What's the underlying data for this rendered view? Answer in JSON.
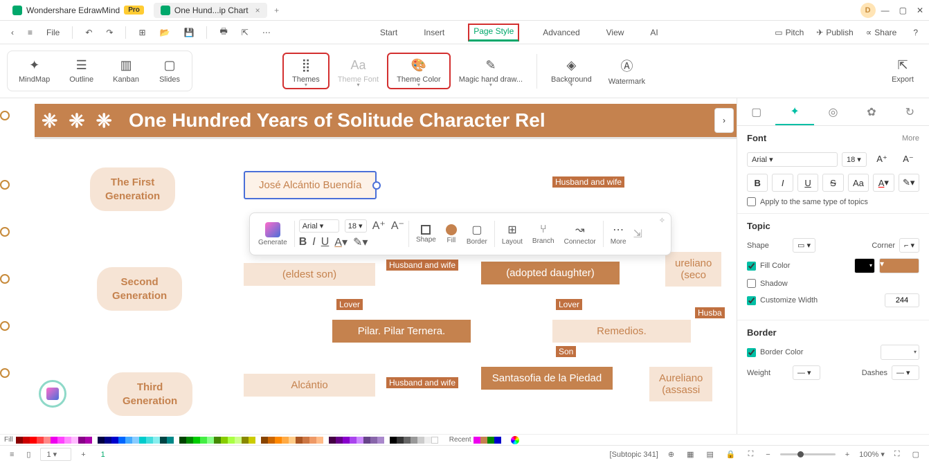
{
  "titlebar": {
    "app_name": "Wondershare EdrawMind",
    "pro_badge": "Pro",
    "doc_tab": "One Hund...ip Chart",
    "avatar_letter": "D"
  },
  "menubar": {
    "file": "File",
    "tabs": {
      "start": "Start",
      "insert": "Insert",
      "page_style": "Page Style",
      "advanced": "Advanced",
      "view": "View",
      "ai": "AI"
    },
    "actions": {
      "pitch": "Pitch",
      "publish": "Publish",
      "share": "Share"
    }
  },
  "ribbon": {
    "view_group": {
      "mindmap": "MindMap",
      "outline": "Outline",
      "kanban": "Kanban",
      "slides": "Slides"
    },
    "style_group": {
      "themes": "Themes",
      "theme_font": "Theme Font",
      "theme_color": "Theme Color",
      "magic_hand": "Magic hand draw...",
      "background": "Background",
      "watermark": "Watermark"
    },
    "export": "Export"
  },
  "canvas": {
    "title": "One Hundred Years of Solitude Character Rel",
    "gen1": "The First\nGeneration",
    "gen2": "Second\nGeneration",
    "gen3": "Third\nGeneration",
    "selected_node": "José Alcántio Buendía",
    "husband_wife": "Husband and wife",
    "eldest_son": "(eldest son)",
    "adopted_daughter": "(adopted daughter)",
    "second": "(seco",
    "aureliano": "ureliano",
    "lover": "Lover",
    "husba": "Husba",
    "pilar": "Pilar. Pilar Ternera.",
    "remedios": "Remedios.",
    "son": "Son",
    "alcantio": "Alcántio",
    "santasofia": "Santasofia de la Piedad",
    "aureliano2": "Aureliano\n(assassi"
  },
  "float_toolbar": {
    "generate": "Generate",
    "font_name": "Arial",
    "font_size": "18",
    "shape": "Shape",
    "fill": "Fill",
    "border": "Border",
    "layout": "Layout",
    "branch": "Branch",
    "connector": "Connector",
    "more": "More"
  },
  "right_panel": {
    "font": {
      "title": "Font",
      "more": "More",
      "name": "Arial",
      "size": "18",
      "apply_same": "Apply to the same type of topics"
    },
    "topic": {
      "title": "Topic",
      "shape": "Shape",
      "corner": "Corner",
      "fill_color": "Fill Color",
      "shadow": "Shadow",
      "customize_width": "Customize Width",
      "width_value": "244"
    },
    "border": {
      "title": "Border",
      "border_color": "Border Color",
      "weight": "Weight",
      "dashes": "Dashes"
    }
  },
  "palette": {
    "fill_label": "Fill",
    "recent_label": "Recent"
  },
  "statusbar": {
    "page": "1",
    "page_num": "1",
    "subtopic": "[Subtopic 341]",
    "zoom": "100%"
  }
}
